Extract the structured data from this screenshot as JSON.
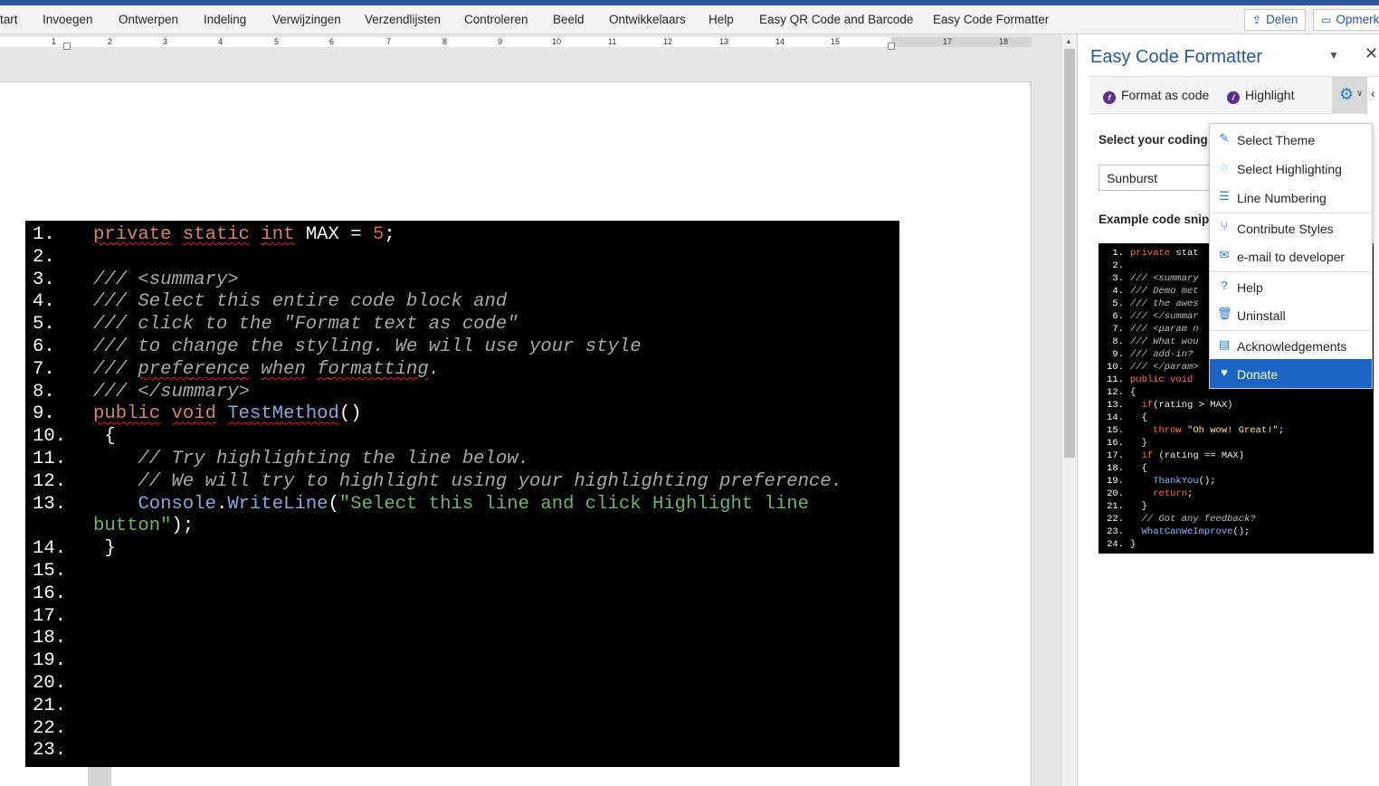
{
  "ribbon": {
    "tabs": [
      "tart",
      "Invoegen",
      "Ontwerpen",
      "Indeling",
      "Verwijzingen",
      "Verzendlijsten",
      "Controleren",
      "Beeld",
      "Ontwikkelaars",
      "Help",
      "Easy QR Code and Barcode",
      "Easy Code Formatter"
    ],
    "share_label": "Delen",
    "comments_label": "Opmerk"
  },
  "ruler": {
    "numbers": [
      "1",
      "2",
      "3",
      "4",
      "5",
      "6",
      "7",
      "8",
      "9",
      "10",
      "11",
      "12",
      "13",
      "14",
      "15",
      "17",
      "18"
    ]
  },
  "document": {
    "code_lines": [
      {
        "n": "1.",
        "t": "private static int MAX = 5;"
      },
      {
        "n": "2.",
        "t": ""
      },
      {
        "n": "3.",
        "t": "/// <summary>"
      },
      {
        "n": "4.",
        "t": "/// Select this entire code block and"
      },
      {
        "n": "5.",
        "t": "/// click to the \"Format text as code\""
      },
      {
        "n": "6.",
        "t": "/// to change the styling. We will use your style"
      },
      {
        "n": "7.",
        "t": "/// preference when formatting."
      },
      {
        "n": "8.",
        "t": "/// </summary>"
      },
      {
        "n": "9.",
        "t": "public void TestMethod()"
      },
      {
        "n": "10.",
        "t": " {"
      },
      {
        "n": "11.",
        "t": "    // Try highlighting the line below."
      },
      {
        "n": "12.",
        "t": "    // We will try to highlight using your highlighting preference."
      },
      {
        "n": "13.",
        "t": "    Console.WriteLine(\"Select this line and click Highlight line"
      },
      {
        "n": "",
        "t": "button\");"
      },
      {
        "n": "14.",
        "t": " }"
      },
      {
        "n": "15.",
        "t": ""
      },
      {
        "n": "16.",
        "t": ""
      },
      {
        "n": "17.",
        "t": ""
      },
      {
        "n": "18.",
        "t": ""
      },
      {
        "n": "19.",
        "t": ""
      },
      {
        "n": "20.",
        "t": ""
      },
      {
        "n": "21.",
        "t": ""
      },
      {
        "n": "22.",
        "t": ""
      },
      {
        "n": "23.",
        "t": ""
      }
    ]
  },
  "pane": {
    "title": "Easy Code Formatter",
    "format_button": "Format as code",
    "highlight_button": "Highlight",
    "coding_label": "Select your coding",
    "theme_value": "Sunburst",
    "example_label": "Example code snip",
    "snippet_lines": [
      {
        "n": "1.",
        "t": "private stat"
      },
      {
        "n": "2.",
        "t": ""
      },
      {
        "n": "3.",
        "t": "/// <summary"
      },
      {
        "n": "4.",
        "t": "/// Demo met"
      },
      {
        "n": "5.",
        "t": "/// the awes"
      },
      {
        "n": "6.",
        "t": "/// </summar"
      },
      {
        "n": "7.",
        "t": "/// <param n"
      },
      {
        "n": "8.",
        "t": "/// What wou"
      },
      {
        "n": "9.",
        "t": "/// add-in?"
      },
      {
        "n": "10.",
        "t": "/// </param>"
      },
      {
        "n": "11.",
        "t": "public void"
      },
      {
        "n": "12.",
        "t": "{"
      },
      {
        "n": "13.",
        "t": "  if(rating > MAX)"
      },
      {
        "n": "14.",
        "t": "  {"
      },
      {
        "n": "15.",
        "t": "    throw \"Oh wow! Great!\";"
      },
      {
        "n": "16.",
        "t": "  }"
      },
      {
        "n": "17.",
        "t": "  if (rating == MAX)"
      },
      {
        "n": "18.",
        "t": "  {"
      },
      {
        "n": "19.",
        "t": "    ThankYou();"
      },
      {
        "n": "20.",
        "t": "    return;"
      },
      {
        "n": "21.",
        "t": "  }"
      },
      {
        "n": "22.",
        "t": "  // Got any feedback?"
      },
      {
        "n": "23.",
        "t": "  WhatCanWeImprove();"
      },
      {
        "n": "24.",
        "t": "}"
      }
    ]
  },
  "menu": {
    "items": [
      {
        "label": "Select Theme",
        "icon": "brush-icon"
      },
      {
        "label": "Select Highlighting",
        "icon": "palette-icon"
      },
      {
        "label": "Line Numbering",
        "icon": "list-icon"
      },
      {
        "label": "Contribute Styles",
        "icon": "branch-icon"
      },
      {
        "label": "e-mail to developer",
        "icon": "mail-icon"
      },
      {
        "label": "Help",
        "icon": "question-icon"
      },
      {
        "label": "Uninstall",
        "icon": "trash-icon"
      },
      {
        "label": "Acknowledgements",
        "icon": "document-icon"
      },
      {
        "label": "Donate",
        "icon": "heart-icon"
      }
    ],
    "active_index": 8
  },
  "colors": {
    "brand": "#2b579a",
    "menu_active": "#1a65c4",
    "code_bg": "#000000"
  }
}
